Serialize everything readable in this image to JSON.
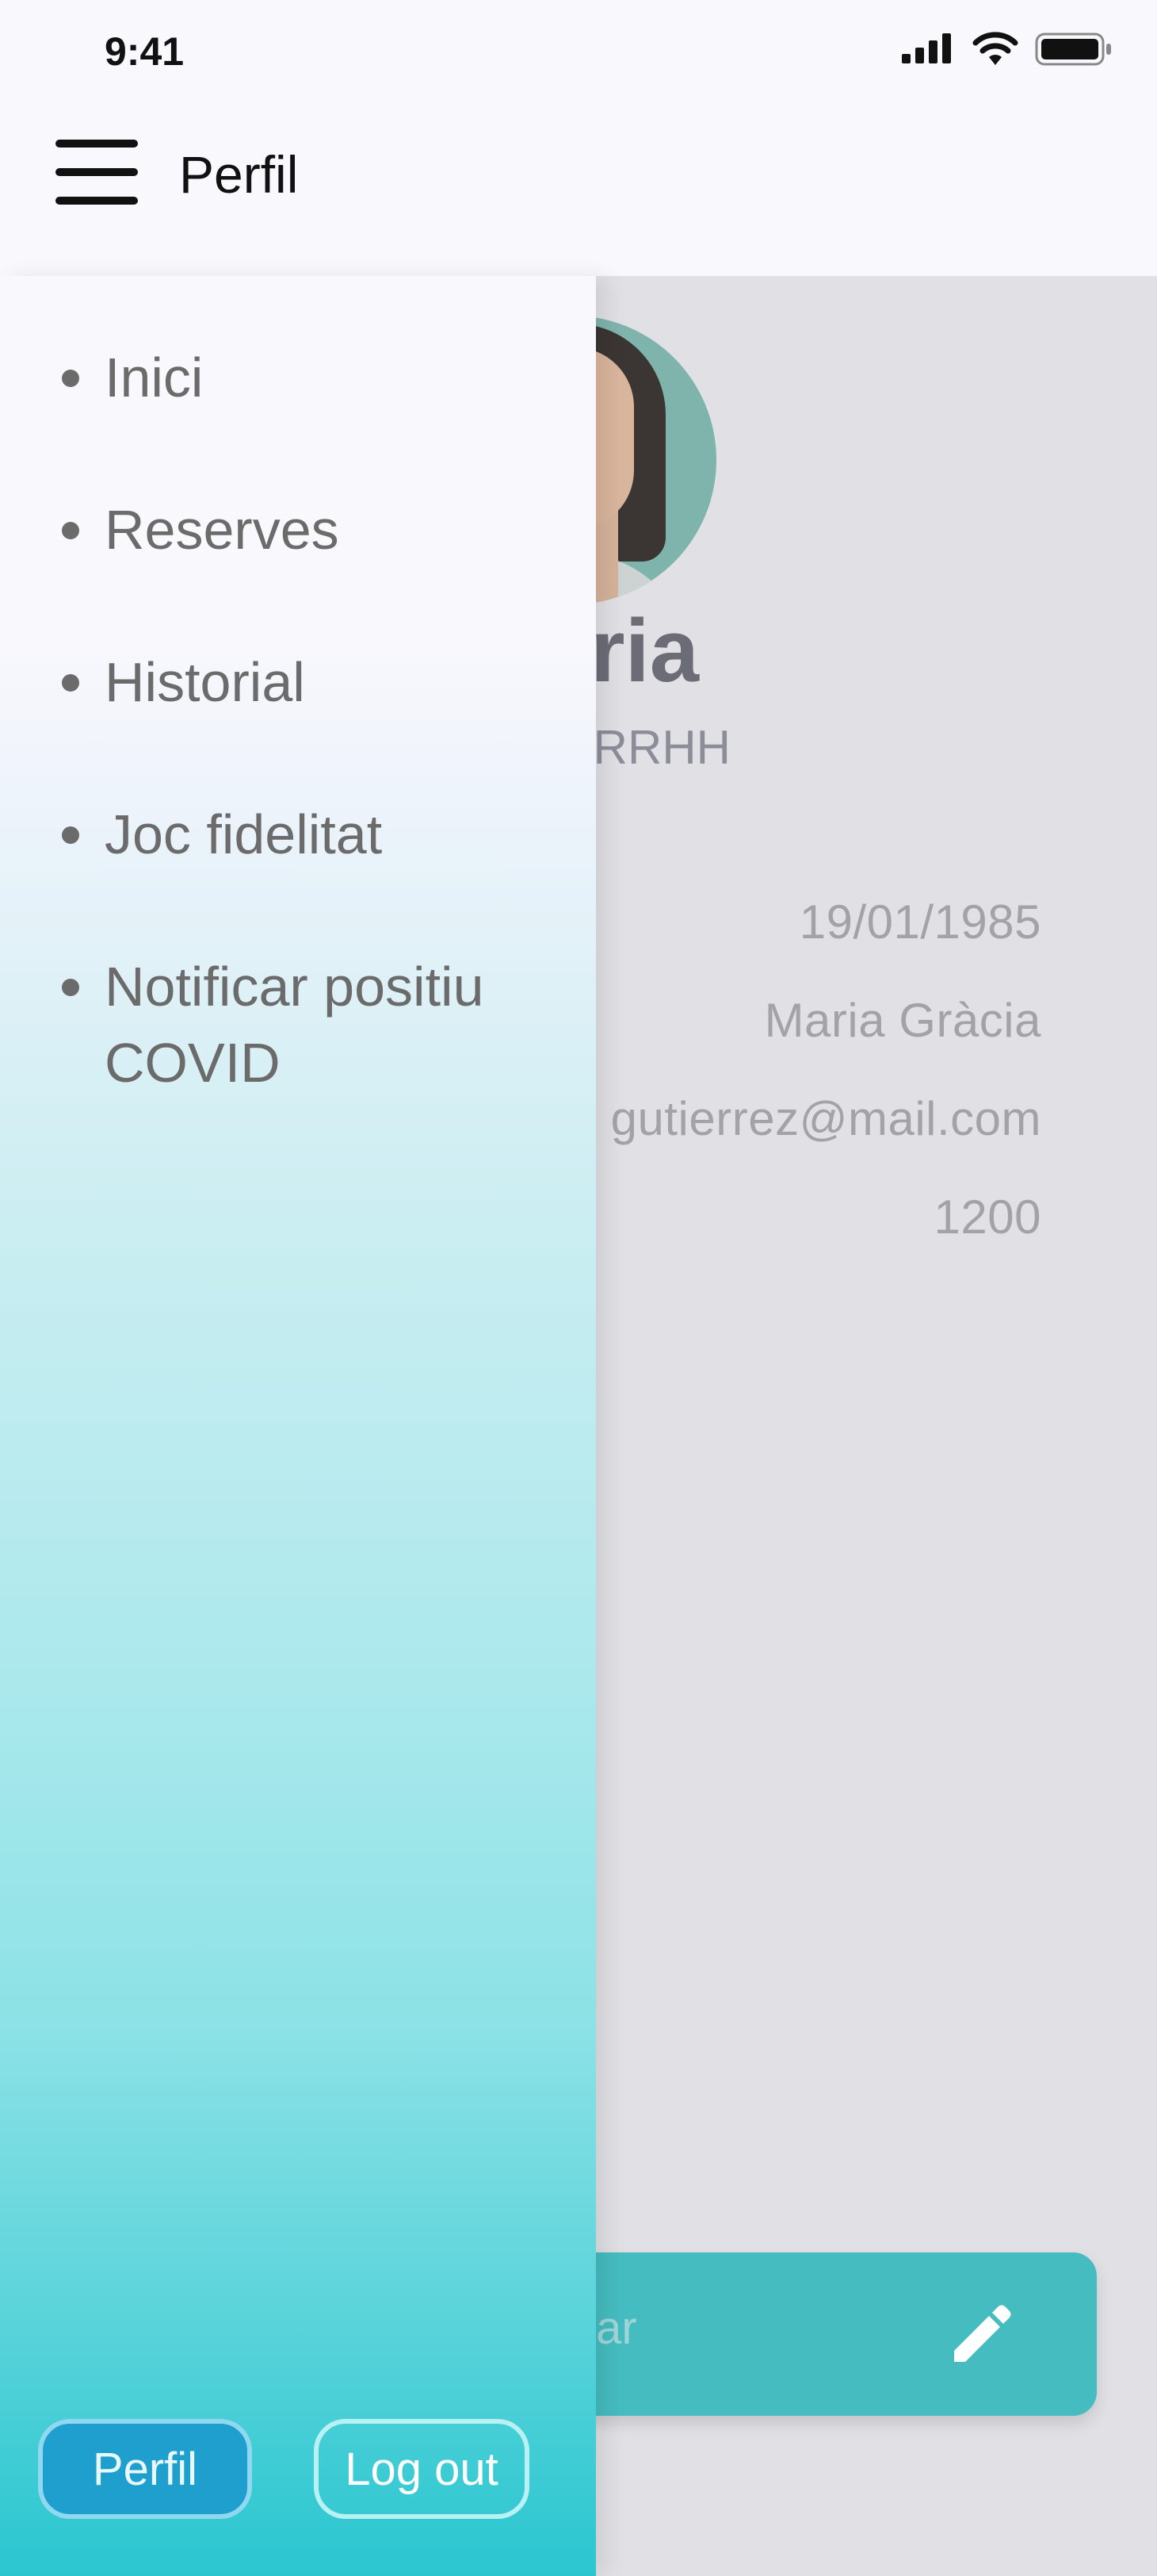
{
  "status_bar": {
    "time": "9:41",
    "icons": [
      "cellular-signal-icon",
      "wifi-icon",
      "battery-icon"
    ]
  },
  "header": {
    "title": "Perfil",
    "menu_icon": "hamburger-menu-icon"
  },
  "drawer": {
    "items": [
      {
        "label": "Inici"
      },
      {
        "label": "Reserves"
      },
      {
        "label": "Historial"
      },
      {
        "label": "Joc fidelitat"
      },
      {
        "label": "Notificar positiu COVID"
      }
    ],
    "buttons": {
      "perfil": "Perfil",
      "logout": "Log out"
    }
  },
  "profile": {
    "name_visible": "ria",
    "role_visible": "RRHH",
    "birth_date": "19/01/1985",
    "full_name": "Maria Gràcia",
    "email_visible": "gutierrez@mail.com",
    "points": "1200",
    "edit_button_visible": "tar",
    "edit_icon": "pencil-icon"
  },
  "colors": {
    "accent": "#1e9fce",
    "teal": "#45bcc0",
    "gradient_bottom": "#2ac6d0",
    "text_gray": "#6b6b6b"
  }
}
